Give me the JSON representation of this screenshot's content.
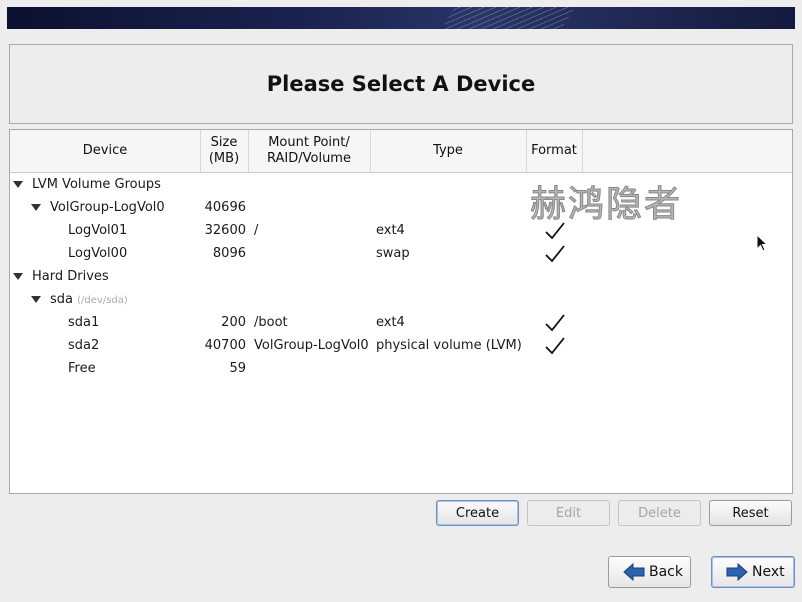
{
  "title": "Please Select A Device",
  "columns": {
    "device": "Device",
    "size_line1": "Size",
    "size_line2": "(MB)",
    "mount_line1": "Mount Point/",
    "mount_line2": "RAID/Volume",
    "type": "Type",
    "format": "Format"
  },
  "rows": [
    {
      "device": "LVM Volume Groups",
      "level": 0,
      "expander": true
    },
    {
      "device": "VolGroup-LogVol0",
      "size": "40696",
      "level": 1,
      "expander": true
    },
    {
      "device": "LogVol01",
      "size": "32600",
      "mount": "/",
      "type": "ext4",
      "format": true,
      "level": 2
    },
    {
      "device": "LogVol00",
      "size": "8096",
      "type": "swap",
      "format": true,
      "level": 2
    },
    {
      "device": "Hard Drives",
      "level": 0,
      "expander": true
    },
    {
      "device": "sda",
      "sub": "(/dev/sda)",
      "level": 1,
      "expander": true
    },
    {
      "device": "sda1",
      "size": "200",
      "mount": "/boot",
      "type": "ext4",
      "format": true,
      "level": 2
    },
    {
      "device": "sda2",
      "size": "40700",
      "mount": "VolGroup-LogVol0",
      "type": "physical volume (LVM)",
      "format": true,
      "level": 2
    },
    {
      "device": "Free",
      "size": "59",
      "level": 2
    }
  ],
  "watermark": "赫鸿隐者",
  "actions": {
    "create": "Create",
    "edit": "Edit",
    "delete": "Delete",
    "reset": "Reset"
  },
  "nav": {
    "back": "Back",
    "next": "Next"
  },
  "colors": {
    "banner": "#1b2452",
    "arrow": "#2a62b0"
  }
}
